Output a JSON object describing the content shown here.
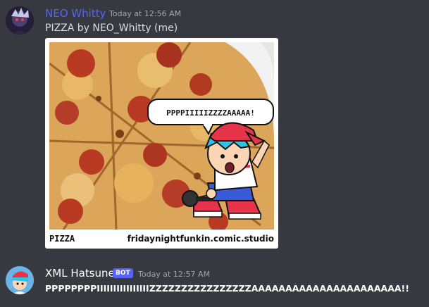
{
  "messages": [
    {
      "username": "NEO Whitty",
      "username_color": "#5865f2",
      "timestamp": "Today at 12:56 AM",
      "content": "PIZZA by NEO_Whitty (me)",
      "avatar_icon": "neo-whitty-avatar-icon",
      "attachment": {
        "speech_bubble": "PPPPIIIIIZZZZAAAAA!",
        "caption_left": "PIZZA",
        "caption_right": "fridaynightfunkin.comic.studio"
      }
    },
    {
      "username": "XML Hatsune",
      "username_color": "#ffffff",
      "bot_tag": "BOT",
      "timestamp": "Today at 12:57 AM",
      "content": "PPPPPPPPIIIIIIIIIIIIIIIIZZZZZZZZZZZZZZZZAAAAAAAAAAAAAAAAAAAAAA!!",
      "avatar_icon": "xml-hatsune-avatar-icon"
    }
  ],
  "colors": {
    "background": "#36393f",
    "bot_badge": "#5865f2",
    "pizza": "#e0a24a",
    "pepperoni": "#b83a22"
  }
}
